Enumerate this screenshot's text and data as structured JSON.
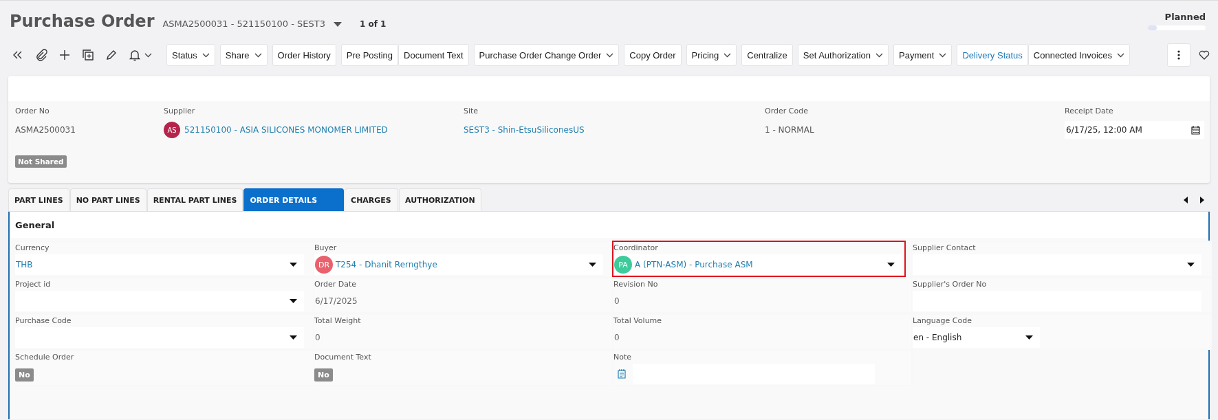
{
  "header": {
    "title": "Purchase Order",
    "record": "ASMA2500031 - 521150100 - SEST3",
    "record_counter": "1 of 1",
    "status": {
      "label": "Planned",
      "level": 0.15
    }
  },
  "toolbar": {
    "icons": [
      {
        "kind": "collapse",
        "dropdown": false
      },
      {
        "kind": "attach",
        "dropdown": false
      },
      {
        "kind": "add",
        "dropdown": false
      },
      {
        "kind": "duplicate",
        "dropdown": false
      },
      {
        "kind": "edit",
        "dropdown": false
      },
      {
        "kind": "bell",
        "dropdown": true
      }
    ],
    "buttons": [
      {
        "label": "Status",
        "dropdown": true,
        "attached": false,
        "kind": "plain"
      },
      {
        "label": "Share",
        "dropdown": true,
        "attached": false,
        "kind": "plain"
      },
      {
        "label": "Order History",
        "dropdown": false,
        "attached": false,
        "kind": "plain"
      },
      {
        "label": "Pre Posting",
        "dropdown": false,
        "attached": false,
        "kind": "plain"
      },
      {
        "label": "Document Text",
        "dropdown": false,
        "attached": true,
        "kind": "plain"
      },
      {
        "label": "Purchase Order Change Order",
        "dropdown": true,
        "attached": false,
        "kind": "plain"
      },
      {
        "label": "Copy Order",
        "dropdown": false,
        "attached": false,
        "kind": "plain"
      },
      {
        "label": "Pricing",
        "dropdown": true,
        "attached": false,
        "kind": "plain"
      },
      {
        "label": "Centralize",
        "dropdown": false,
        "attached": false,
        "kind": "plain"
      },
      {
        "label": "Set Authorization",
        "dropdown": true,
        "attached": false,
        "kind": "plain"
      },
      {
        "label": "Payment",
        "dropdown": true,
        "attached": false,
        "kind": "plain"
      },
      {
        "label": "Delivery Status",
        "dropdown": false,
        "attached": false,
        "kind": "link"
      },
      {
        "label": "Connected Invoices",
        "dropdown": true,
        "attached": true,
        "kind": "plain"
      }
    ]
  },
  "header_card": {
    "fields": [
      {
        "label": "Order No",
        "value": "ASMA2500031",
        "kind": "text"
      },
      {
        "label": "Supplier",
        "value": "521150100 - ASIA SILICONES MONOMER LIMITED",
        "kind": "avatar_link",
        "avatar": {
          "initials": "AS",
          "color": "#b5254b"
        }
      },
      {
        "label": "Site",
        "value": "SEST3 - Shin-EtsuSiliconesUS",
        "kind": "link"
      },
      {
        "label": "Order Code",
        "value": "1 - NORMAL",
        "kind": "text"
      },
      {
        "label": "Receipt Date",
        "value": "6/17/25, 12:00 AM",
        "kind": "date"
      }
    ],
    "badge": "Not Shared"
  },
  "tabs": [
    {
      "label": "PART LINES",
      "selected": false
    },
    {
      "label": "NO PART LINES",
      "selected": false
    },
    {
      "label": "RENTAL PART LINES",
      "selected": false
    },
    {
      "label": "ORDER DETAILS",
      "selected": true
    },
    {
      "label": "CHARGES",
      "selected": false
    },
    {
      "label": "AUTHORIZATION",
      "selected": false
    }
  ],
  "form": {
    "section": "General",
    "fields": [
      {
        "label": "Currency",
        "value": "THB",
        "kind": "select",
        "highlighted": false
      },
      {
        "label": "Buyer",
        "value": "T254 - Dhanit Rerngthye",
        "kind": "select",
        "highlighted": false,
        "avatar": {
          "initials": "DR",
          "color": "#e8616d"
        }
      },
      {
        "label": "Coordinator",
        "value": "A (PTN-ASM) - Purchase ASM",
        "kind": "select",
        "highlighted": true,
        "avatar": {
          "initials": "PA",
          "color": "#3ecb9c"
        }
      },
      {
        "label": "Supplier Contact",
        "kind": "select",
        "highlighted": false
      },
      {
        "label": "Project id",
        "kind": "select",
        "highlighted": false
      },
      {
        "label": "Order Date",
        "value": "6/17/2025",
        "kind": "readonly",
        "highlighted": false
      },
      {
        "label": "Revision No",
        "value": "0",
        "kind": "readonly",
        "highlighted": false
      },
      {
        "label": "Supplier's Order No",
        "kind": "input",
        "highlighted": false
      },
      {
        "label": "Purchase Code",
        "kind": "select",
        "highlighted": false
      },
      {
        "label": "Total Weight",
        "value": "0",
        "kind": "readonly",
        "highlighted": false
      },
      {
        "label": "Total Volume",
        "value": "0",
        "kind": "readonly",
        "highlighted": false
      },
      {
        "label": "Language Code",
        "value": "en - English",
        "kind": "short_select",
        "highlighted": false
      },
      {
        "label": "Schedule Order",
        "value": "No",
        "kind": "toggle",
        "highlighted": false
      },
      {
        "label": "Document Text",
        "value": "No",
        "kind": "toggle",
        "highlighted": false
      },
      {
        "label": "Note",
        "kind": "note",
        "highlighted": false
      }
    ]
  }
}
